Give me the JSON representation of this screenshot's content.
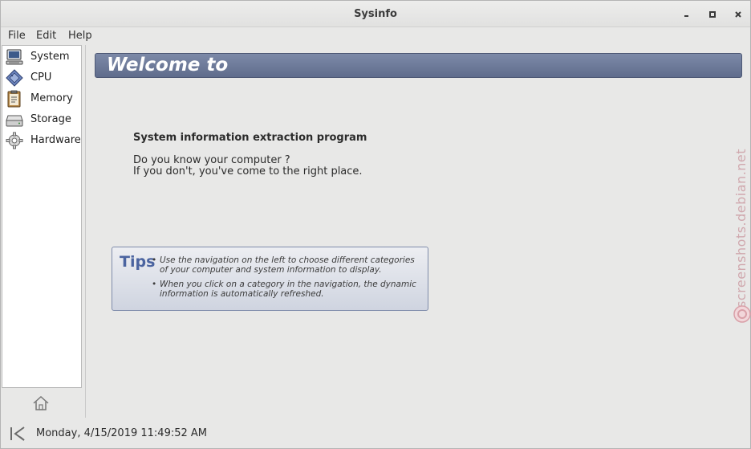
{
  "window": {
    "title": "Sysinfo",
    "minimize_icon": "minimize-icon",
    "maximize_icon": "maximize-icon",
    "close_icon": "close-icon"
  },
  "menubar": {
    "items": [
      {
        "label": "File"
      },
      {
        "label": "Edit"
      },
      {
        "label": "Help"
      }
    ]
  },
  "sidebar": {
    "items": [
      {
        "label": "System",
        "icon": "computer-icon"
      },
      {
        "label": "CPU",
        "icon": "cpu-chip-icon"
      },
      {
        "label": "Memory",
        "icon": "memory-clipboard-icon"
      },
      {
        "label": "Storage",
        "icon": "hard-drive-icon"
      },
      {
        "label": "Hardware",
        "icon": "gear-icon"
      }
    ],
    "home_icon": "home-icon"
  },
  "main": {
    "banner": "Welcome to",
    "intro_title": "System information extraction program",
    "intro_lines": [
      "Do you know your computer ?",
      "If you don't, you've come to the right place."
    ],
    "tips": {
      "heading": "Tips",
      "items": [
        "Use the navigation on the left to choose different categories of your computer and system information to display.",
        "When you click on a category in the navigation, the dynamic information is automatically refreshed."
      ]
    }
  },
  "watermark": "screenshots.debian.net",
  "statusbar": {
    "icon": "app-logo-icon",
    "datetime": "Monday, 4/15/2019 11:49:52 AM"
  },
  "colors": {
    "banner": "#6b7898",
    "tips_heading": "#4b64a0",
    "background": "#e8e8e7"
  }
}
